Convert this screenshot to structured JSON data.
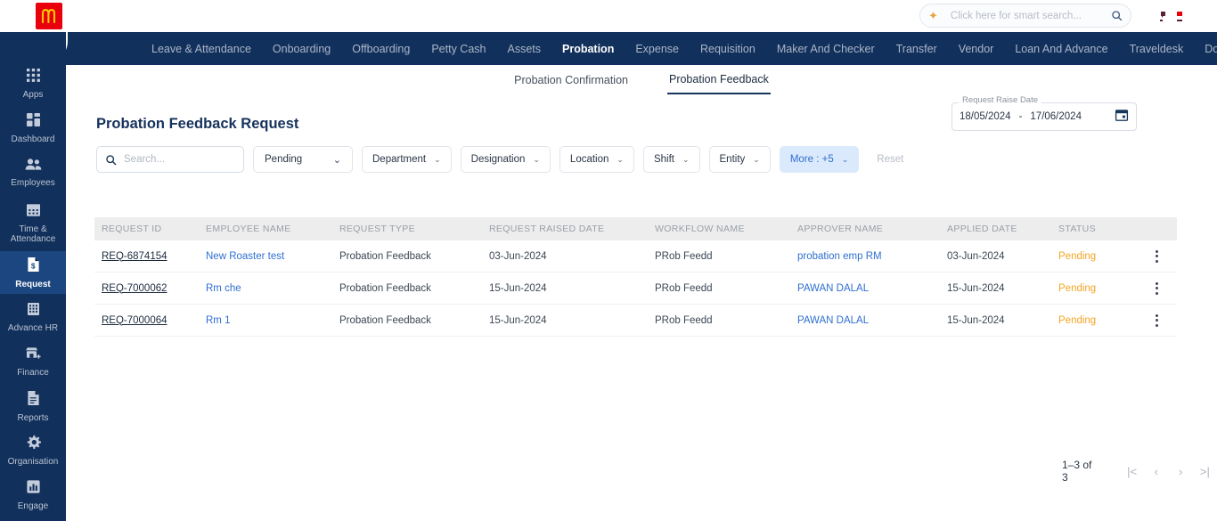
{
  "topbar": {
    "logo_name": "mcdonalds-logo",
    "search_placeholder": "Click here for smart search...",
    "sparkle_icon": "sparkle-icon",
    "search_icon": "search-icon"
  },
  "nav": {
    "items": [
      {
        "label": "Leave & Attendance",
        "active": false
      },
      {
        "label": "Onboarding",
        "active": false
      },
      {
        "label": "Offboarding",
        "active": false
      },
      {
        "label": "Petty Cash",
        "active": false
      },
      {
        "label": "Assets",
        "active": false
      },
      {
        "label": "Probation",
        "active": true
      },
      {
        "label": "Expense",
        "active": false
      },
      {
        "label": "Requisition",
        "active": false
      },
      {
        "label": "Maker And Checker",
        "active": false
      },
      {
        "label": "Transfer",
        "active": false
      },
      {
        "label": "Vendor",
        "active": false
      },
      {
        "label": "Loan And Advance",
        "active": false
      },
      {
        "label": "Traveldesk",
        "active": false
      },
      {
        "label": "Document",
        "active": false
      }
    ]
  },
  "sidebar": {
    "items": [
      {
        "label": "Apps",
        "icon": "grid-apps-icon",
        "active": false
      },
      {
        "label": "Dashboard",
        "icon": "dashboard-icon",
        "active": false
      },
      {
        "label": "Employees",
        "icon": "people-icon",
        "active": false
      },
      {
        "label": "Time & Attendance",
        "icon": "calendar-icon",
        "active": false
      },
      {
        "label": "Request",
        "icon": "document-dollar-icon",
        "active": true
      },
      {
        "label": "Advance HR",
        "icon": "building-icon",
        "active": false
      },
      {
        "label": "Finance",
        "icon": "store-plus-icon",
        "active": false
      },
      {
        "label": "Reports",
        "icon": "report-document-icon",
        "active": false
      },
      {
        "label": "Organisation",
        "icon": "gear-icon",
        "active": false
      },
      {
        "label": "Engage",
        "icon": "bar-chart-icon",
        "active": false
      }
    ]
  },
  "subtabs": [
    {
      "label": "Probation Confirmation",
      "active": false
    },
    {
      "label": "Probation Feedback",
      "active": true
    }
  ],
  "page": {
    "title": "Probation Feedback Request"
  },
  "date_range": {
    "legend": "Request Raise Date",
    "from": "18/05/2024",
    "separator": "-",
    "to": "17/06/2024",
    "calendar_icon": "calendar-icon"
  },
  "export": {
    "icon": "excel-export-icon"
  },
  "filters": {
    "search_placeholder": "Search...",
    "status": {
      "label": "Pending"
    },
    "chips": [
      {
        "label": "Department"
      },
      {
        "label": "Designation"
      },
      {
        "label": "Location"
      },
      {
        "label": "Shift"
      },
      {
        "label": "Entity"
      }
    ],
    "more": {
      "label": "More : +5"
    },
    "reset": {
      "label": "Reset"
    }
  },
  "table": {
    "columns": [
      "REQUEST ID",
      "EMPLOYEE NAME",
      "REQUEST TYPE",
      "REQUEST RAISED DATE",
      "WORKFLOW NAME",
      "APPROVER NAME",
      "APPLIED DATE",
      "STATUS"
    ],
    "rows": [
      {
        "request_id": "REQ-6874154",
        "employee_name": "New Roaster test",
        "request_type": "Probation Feedback",
        "request_raised_date": "03-Jun-2024",
        "workflow_name": "PRob Feedd",
        "approver_name": "probation emp RM",
        "applied_date": "03-Jun-2024",
        "status": "Pending"
      },
      {
        "request_id": "REQ-7000062",
        "employee_name": "Rm che",
        "request_type": "Probation Feedback",
        "request_raised_date": "15-Jun-2024",
        "workflow_name": "PRob Feedd",
        "approver_name": "PAWAN DALAL",
        "applied_date": "15-Jun-2024",
        "status": "Pending"
      },
      {
        "request_id": "REQ-7000064",
        "employee_name": "Rm 1",
        "request_type": "Probation Feedback",
        "request_raised_date": "15-Jun-2024",
        "workflow_name": "PRob Feedd",
        "approver_name": "PAWAN DALAL",
        "applied_date": "15-Jun-2024",
        "status": "Pending"
      }
    ]
  },
  "pagination": {
    "range_text": "1–3 of 3",
    "first": "|<",
    "prev": "‹",
    "next": "›",
    "last": ">|"
  },
  "colors": {
    "navy": "#12305c",
    "accent_blue": "#2f6fd0",
    "status_pending": "#f5a524",
    "brand_red": "#e8000d"
  }
}
